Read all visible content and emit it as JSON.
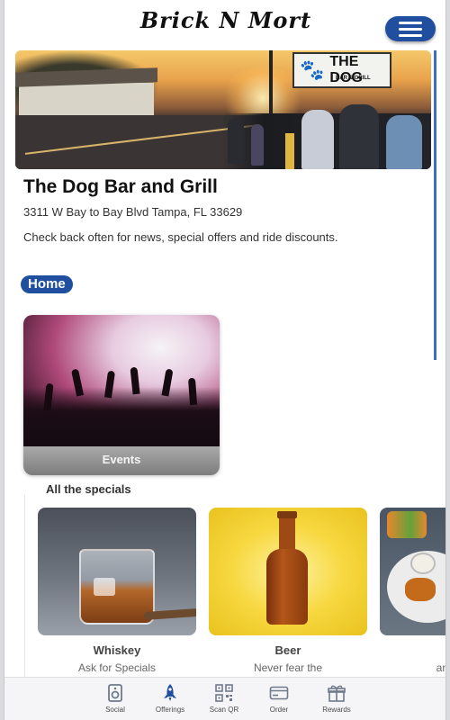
{
  "header": {
    "logo_text": "Brick N Mort",
    "menu_icon": "hamburger-menu-icon"
  },
  "hero": {
    "sign_text": "THE DOG",
    "sign_subtext": "BAR & GRILL"
  },
  "venue": {
    "name": "The Dog Bar and Grill",
    "address": "3311 W Bay to Bay Blvd Tampa, FL 33629",
    "tagline": "Check back often for news, special offers and ride discounts."
  },
  "home_label": "Home",
  "events": {
    "label": "Events"
  },
  "specials": {
    "title": "All the specials",
    "items": [
      {
        "name": "Whiskey",
        "desc": "Ask for Specials"
      },
      {
        "name": "Beer",
        "desc": "Never fear the"
      },
      {
        "name": "",
        "desc": "an"
      }
    ]
  },
  "bottom_nav": [
    {
      "label": "Social",
      "icon": "speaker-icon"
    },
    {
      "label": "Offerings",
      "icon": "rocket-icon"
    },
    {
      "label": "Scan QR",
      "icon": "qr-code-icon"
    },
    {
      "label": "Order",
      "icon": "card-icon"
    },
    {
      "label": "Rewards",
      "icon": "gift-icon"
    }
  ],
  "colors": {
    "accent": "#1f4f9e",
    "nav_active": "#1f4f9e",
    "nav_inactive": "#6f7a8c"
  }
}
